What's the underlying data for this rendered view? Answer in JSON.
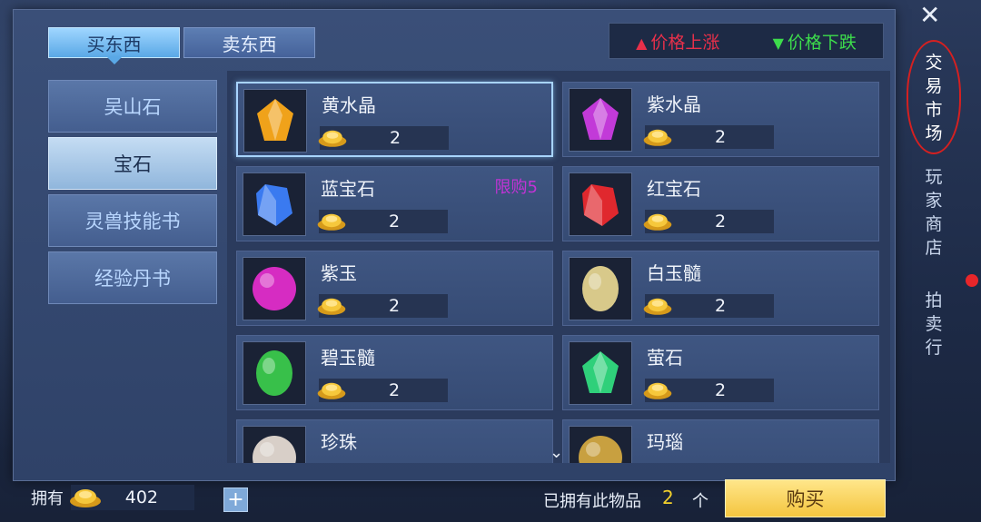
{
  "tabs": [
    {
      "label": "买东西",
      "active": true
    },
    {
      "label": "卖东西",
      "active": false
    }
  ],
  "legend": {
    "up_label": "价格上涨",
    "down_label": "价格下跌",
    "up_color": "#e8304a",
    "down_color": "#3ddc4c"
  },
  "categories": [
    {
      "label": "吴山石",
      "active": false
    },
    {
      "label": "宝石",
      "active": true
    },
    {
      "label": "灵兽技能书",
      "active": false
    },
    {
      "label": "经验丹书",
      "active": false
    }
  ],
  "items": [
    {
      "name": "黄水晶",
      "price": "2",
      "limit": "",
      "color": "#f0a21a",
      "shape": "gem",
      "selected": true
    },
    {
      "name": "紫水晶",
      "price": "2",
      "limit": "",
      "color": "#c23ad8",
      "shape": "gem",
      "selected": false
    },
    {
      "name": "蓝宝石",
      "price": "2",
      "limit": "限购5",
      "color": "#3a7af0",
      "shape": "crystal",
      "selected": false
    },
    {
      "name": "红宝石",
      "price": "2",
      "limit": "",
      "color": "#e0282e",
      "shape": "crystal",
      "selected": false
    },
    {
      "name": "紫玉",
      "price": "2",
      "limit": "",
      "color": "#d62cc2",
      "shape": "orb",
      "selected": false
    },
    {
      "name": "白玉髓",
      "price": "2",
      "limit": "",
      "color": "#d8c98a",
      "shape": "oval",
      "selected": false
    },
    {
      "name": "碧玉髓",
      "price": "2",
      "limit": "",
      "color": "#38c04a",
      "shape": "oval",
      "selected": false
    },
    {
      "name": "萤石",
      "price": "2",
      "limit": "",
      "color": "#2fd07a",
      "shape": "gem",
      "selected": false
    },
    {
      "name": "珍珠",
      "price": "",
      "limit": "",
      "color": "#d8cfc8",
      "shape": "orb",
      "selected": false
    },
    {
      "name": "玛瑙",
      "price": "",
      "limit": "",
      "color": "#c8a040",
      "shape": "orb",
      "selected": false
    }
  ],
  "footer": {
    "own_label": "拥有",
    "own_value": "402",
    "plus_label": "+",
    "have_text": "已拥有此物品",
    "have_count": "2",
    "have_unit": "个",
    "buy_label": "购买"
  },
  "nav": [
    {
      "label": "交易市场",
      "active": true
    },
    {
      "label": "玩家商店",
      "active": false
    },
    {
      "label": "拍卖行",
      "active": false
    }
  ]
}
